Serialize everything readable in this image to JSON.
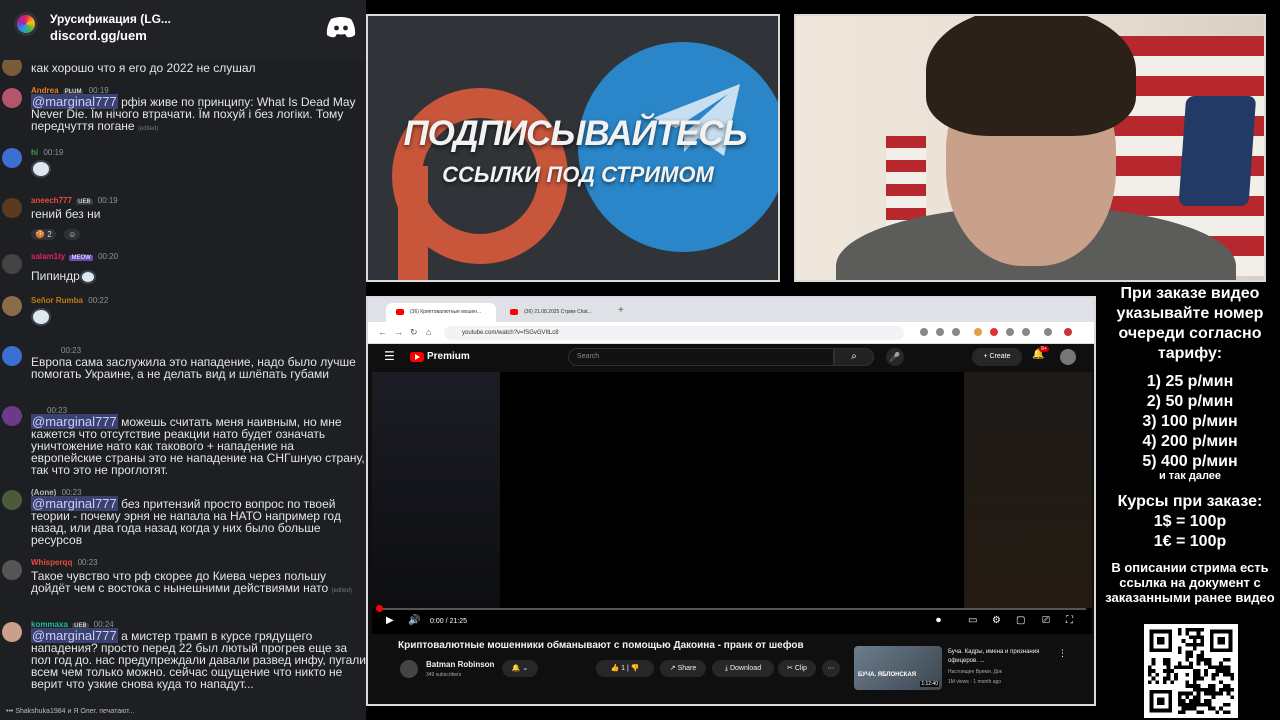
{
  "chat": {
    "server_name": "Урусификация (LG...",
    "server_link": "discord.gg/uem",
    "messages": [
      {
        "text": "как хорошо что я его до 2022 не слушал"
      },
      {
        "user": "Andrea",
        "badge": "PLUM",
        "time": "00:19",
        "mention": "@marginal777",
        "text": " рфія живе по принципу: What Is Dead May Never Die. Їм нічого втрачати. Їм похуй і без логіки. Тому передчуття погане",
        "edited": "(edited)"
      },
      {
        "user": "hi",
        "time": "00:19"
      },
      {
        "user": "aneech777",
        "badge": "UEB",
        "time": "00:19",
        "text": "гений без ни",
        "reaction_count": "2"
      },
      {
        "user": "salam1ty",
        "badge": "MEOW",
        "time": "00:20",
        "text": "Пипиндр"
      },
      {
        "user": "Señor Rumba",
        "time": "00:22"
      },
      {
        "time": "00:23",
        "text": "Европа сама заслужила это нападение, надо было лучше помогать Украине, а не делать вид и шлёпать губами"
      },
      {
        "time": "00:23",
        "mention": "@marginal777",
        "text": " можешь считать меня наивным, но мне кажется что отсутствие реакции нато будет означать уничтожение нато как такового + нападение на европейские страны это не нападение на СНГшную страну, так что это не проглотят."
      },
      {
        "user": "(Aone)",
        "time": "00:23",
        "mention": "@marginal777",
        "text": " без притензий просто вопрос по твоей теории - почему эрня не напала на НАТО например год назад, или два года назад когда у них было больше ресурсов"
      },
      {
        "user": "Whisperqq",
        "time": "00:23",
        "text": "Такое чувство что рф скорее до Киева через польшу дойдёт чем с востока с нынешними действиями нато",
        "edited": "(edited)"
      },
      {
        "user": "kommaxa",
        "badge": "UEB",
        "time": "00:24",
        "mention": "@marginal777",
        "text": " а мистер трамп в курсе грядущего нападения? просто перед 22 был лютый прогрев еще за пол год до. нас предупреждали давали развед инфу, пугали всем чем только можно. сейчас ощущение что никто не верит что узкие снова куда то нападут..."
      }
    ],
    "typing": "Shakshuka1984 и Я Олег. печатают..."
  },
  "banner": {
    "headline": "ПОДПИСЫВАЙТЕСЬ",
    "subline": "ССЫЛКИ ПОД СТРИМОМ"
  },
  "browser": {
    "tab1": "(36) Криптовалютные мошен...",
    "tab2": "(36) 21.08.2025 Стрим Chat...",
    "url": "youtube.com/watch?v=fSGvGVItLc8",
    "yt_brand": "Premium",
    "search_placeholder": "Search",
    "create_label": "Create",
    "notif_count": "9+",
    "player_time": "0:00 / 21:25",
    "progress": 0,
    "video_title": "Криптовалютные мошенники обманывают с помощью Дакоина - пранк от шефов",
    "channel_name": "Batman Robinson",
    "channel_subs": "349 subscribers",
    "like_count": "1",
    "share_label": "Share",
    "download_label": "Download",
    "clip_label": "Clip",
    "reco": {
      "overlay": "БУЧА. ЯБЛОНСКАЯ",
      "duration": "1:12:40",
      "title": "Буча. Кадры, имена и признания офицеров. ...",
      "channel": "Настоящее Время. Док",
      "stats": "1M views · 1 month ago"
    }
  },
  "info": {
    "heading": "При заказе видео указывайте номер очереди согласно тарифу:",
    "rates": [
      "1) 25 р/мин",
      "2) 50 р/мин",
      "3) 100 р/мин",
      "4) 200 р/мин",
      "5) 400 р/мин"
    ],
    "etc": "и так далее",
    "rates_title": "Курсы при заказе:",
    "usd": "1$ = 100р",
    "eur": "1€ = 100р",
    "desc": "В описании стрима есть ссылка на документ с заказанными ранее видео"
  }
}
